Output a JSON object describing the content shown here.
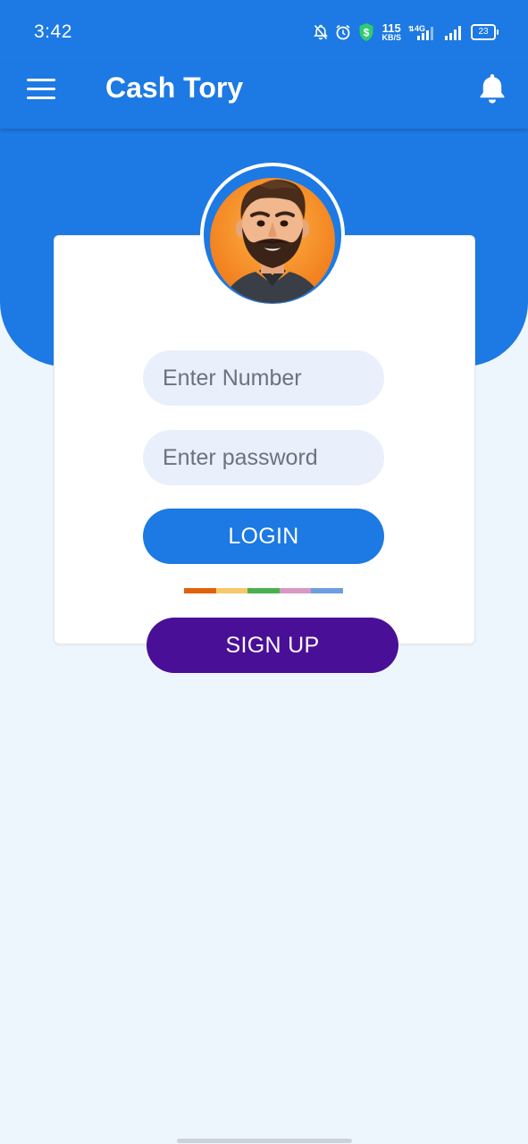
{
  "status_bar": {
    "time": "3:42",
    "net_speed_value": "115",
    "net_speed_unit": "KB/S",
    "network_type": "4G",
    "battery": "23",
    "icons": [
      "mute-bell-icon",
      "alarm-icon",
      "shield-dollar-icon",
      "data-arrows-icon",
      "signal-icon",
      "signal-icon",
      "battery-icon"
    ]
  },
  "app_bar": {
    "title": "Cash Tory",
    "menu_icon": "hamburger-menu-icon",
    "notification_icon": "bell-icon"
  },
  "login_form": {
    "number_placeholder": "Enter Number",
    "password_placeholder": "Enter password",
    "login_label": "LOGIN",
    "signup_label": "SIGN UP"
  },
  "divider_colors": [
    "#e0620f",
    "#f7c86a",
    "#4caf50",
    "#d799c1",
    "#6d9ee0"
  ],
  "colors": {
    "primary": "#1d79e3",
    "signup": "#4a0f97",
    "background": "#eef6fd",
    "input_bg": "#e9f0fb"
  }
}
